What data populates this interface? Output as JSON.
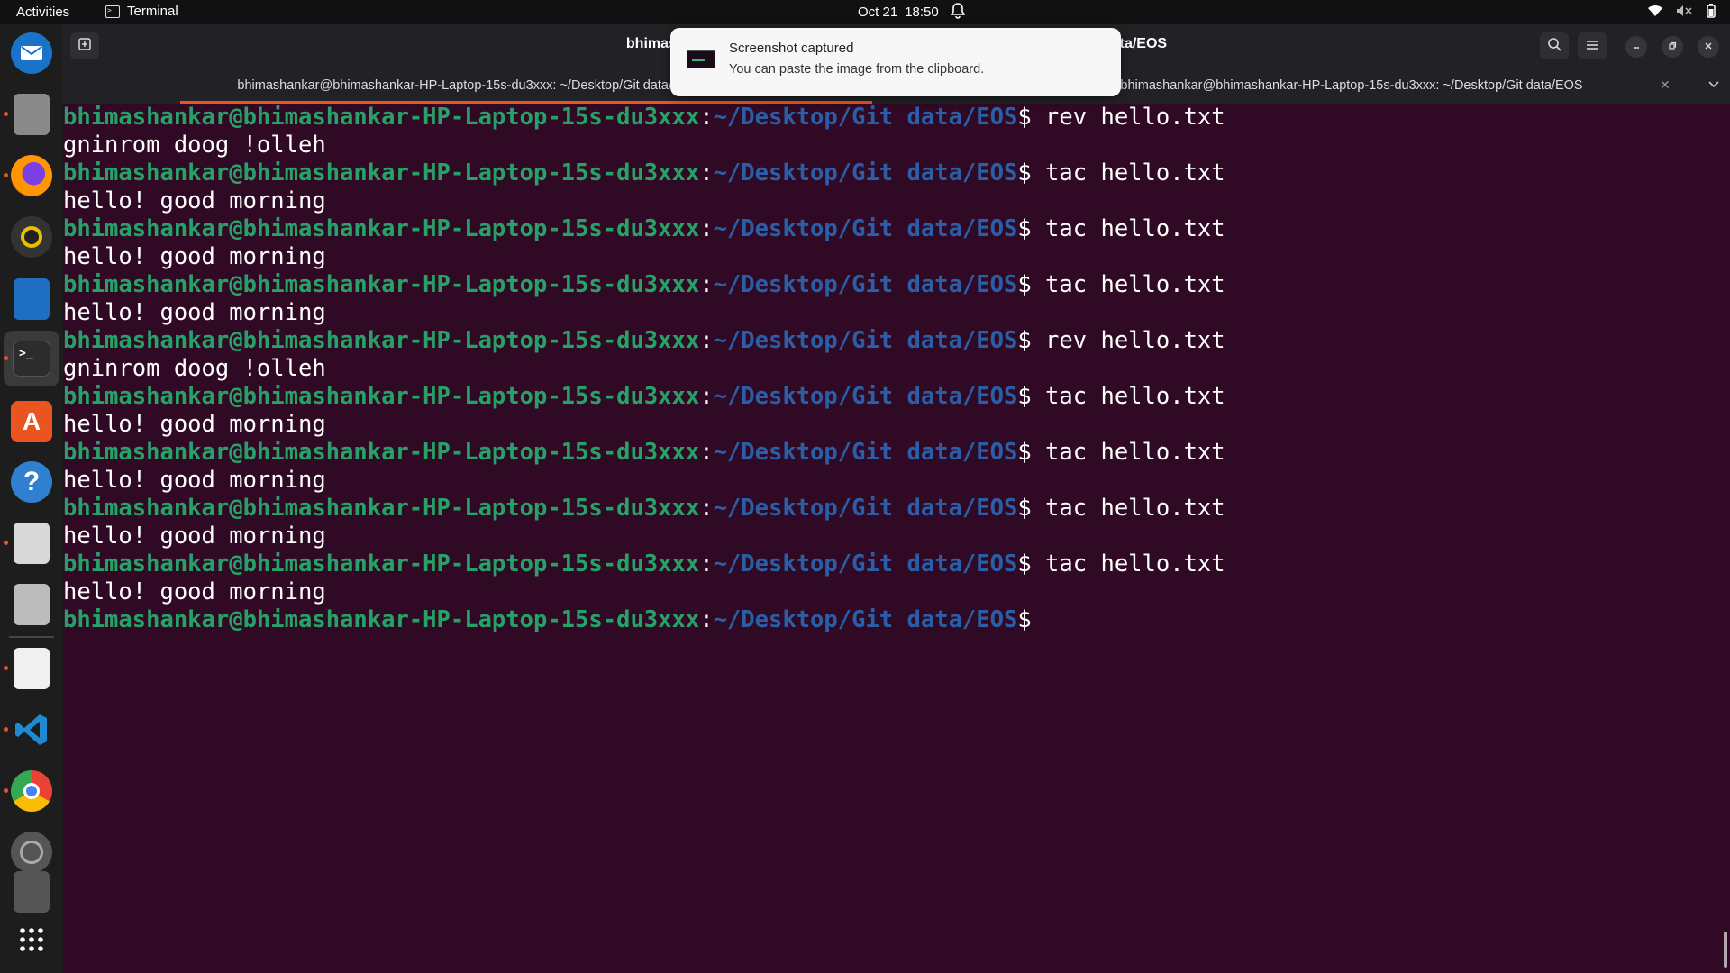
{
  "topbar": {
    "activities": "Activities",
    "app_name": "Terminal",
    "date": "Oct 21",
    "time": "18:50"
  },
  "window": {
    "title": "bhimashankar@bhimashankar-HP-Laptop-15s-du3xxx: ~/Desktop/Git data/EOS",
    "tabs": [
      {
        "label": "bhimashankar@bhimashankar-HP-Laptop-15s-du3xxx: ~/Desktop/Git data/EOS",
        "active": true
      },
      {
        "label": "bhimashankar@bhimashankar-HP-Laptop-15s-du3xxx: ~/Desktop/Git data/EOS",
        "active": false
      }
    ]
  },
  "notification": {
    "title": "Screenshot captured",
    "body": "You can paste the image from the clipboard."
  },
  "prompt": {
    "user": "bhimashankar@bhimashankar-HP-Laptop-15s-du3xxx",
    "colon": ":",
    "path": "~/Desktop/Git data/EOS",
    "dollar": "$"
  },
  "terminal_lines": [
    {
      "type": "cmd",
      "text": " rev hello.txt"
    },
    {
      "type": "out",
      "text": "gninrom doog !olleh"
    },
    {
      "type": "cmd",
      "text": " tac hello.txt"
    },
    {
      "type": "out",
      "text": "hello! good morning"
    },
    {
      "type": "cmd",
      "text": " tac hello.txt"
    },
    {
      "type": "out",
      "text": "hello! good morning"
    },
    {
      "type": "cmd",
      "text": " tac hello.txt"
    },
    {
      "type": "out",
      "text": "hello! good morning"
    },
    {
      "type": "cmd",
      "text": " rev hello.txt"
    },
    {
      "type": "out",
      "text": "gninrom doog !olleh"
    },
    {
      "type": "cmd",
      "text": " tac hello.txt"
    },
    {
      "type": "out",
      "text": "hello! good morning"
    },
    {
      "type": "cmd",
      "text": " tac hello.txt"
    },
    {
      "type": "out",
      "text": "hello! good morning"
    },
    {
      "type": "cmd",
      "text": " tac hello.txt"
    },
    {
      "type": "out",
      "text": "hello! good morning"
    },
    {
      "type": "cmd",
      "text": " tac hello.txt"
    },
    {
      "type": "out",
      "text": "hello! good morning"
    },
    {
      "type": "cmd",
      "text": ""
    }
  ],
  "dock": [
    {
      "name": "thunderbird-icon",
      "color": "#1a73c9",
      "running": false
    },
    {
      "name": "files-icon",
      "color": "#8a8a8a",
      "running": true
    },
    {
      "name": "firefox-icon",
      "color": "#e66000",
      "running": true
    },
    {
      "name": "rhythmbox-icon",
      "color": "#e8c000",
      "running": false
    },
    {
      "name": "writer-icon",
      "color": "#1e6fc2",
      "running": false
    },
    {
      "name": "terminal-icon",
      "color": "#2c2c2c",
      "running": true,
      "active": true
    },
    {
      "name": "app-center-icon",
      "color": "#e95420",
      "running": false
    },
    {
      "name": "help-icon",
      "color": "#2f80d1",
      "running": false
    },
    {
      "name": "document-viewer-icon",
      "color": "#d9d9d9",
      "running": true
    },
    {
      "name": "image-viewer-icon",
      "color": "#bcbcbc",
      "running": false
    },
    {
      "name": "text-editor-icon",
      "color": "#f0f0f0",
      "running": true
    },
    {
      "name": "vscode-icon",
      "color": "#1f8ad2",
      "running": true
    },
    {
      "name": "chrome-icon",
      "color": "#4285f4",
      "running": true
    },
    {
      "name": "disk-icon",
      "color": "#777777",
      "running": false
    },
    {
      "name": "drive-icon",
      "color": "#555555",
      "running": false
    },
    {
      "name": "show-apps-icon",
      "color": "#1d1d1d",
      "running": false
    }
  ]
}
